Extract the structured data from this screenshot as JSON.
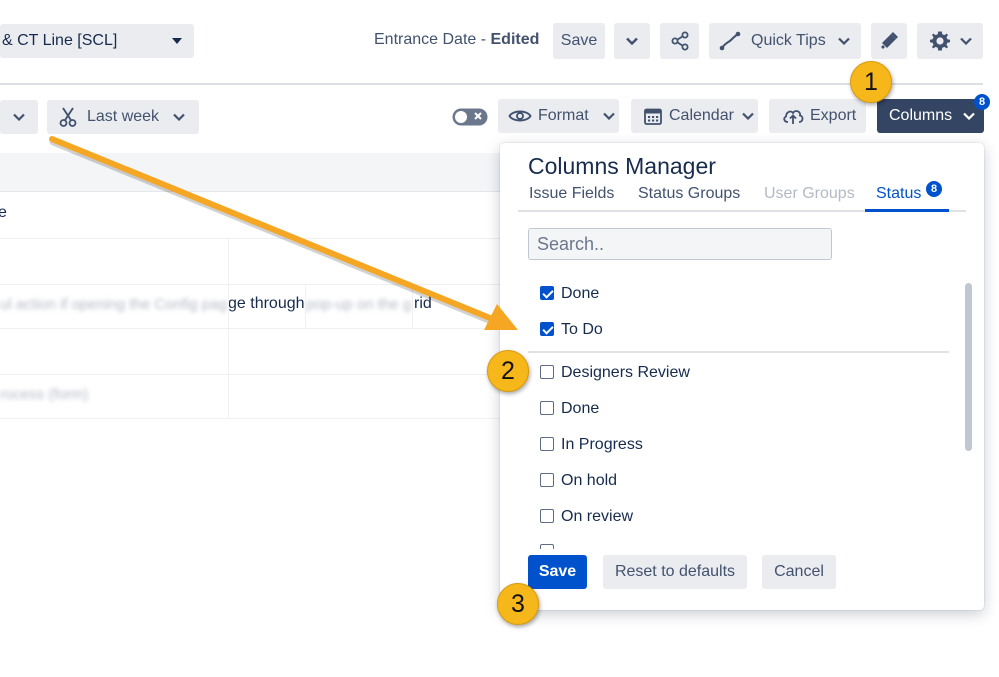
{
  "header": {
    "selector_label": "& CT Line [SCL]",
    "title_prefix": "Entrance Date - ",
    "title_status": "Edited",
    "save_label": "Save",
    "quick_tips_label": "Quick Tips"
  },
  "toolbar": {
    "date_filter_label": "Last week",
    "format_label": "Format",
    "calendar_label": "Calendar",
    "export_label": "Export",
    "columns_label": "Columns",
    "columns_badge": "8"
  },
  "grid": {
    "row1_text": "e",
    "row3_blur_left": "ul action if opening the Config page through",
    "row3_visible": "ge through",
    "row3_blur_right": "pop-up on the g",
    "row3_end": "rid",
    "row5_blur": "rocess (form)"
  },
  "columns_manager": {
    "title": "Columns Manager",
    "tabs": [
      {
        "label": "Issue Fields",
        "state": "normal"
      },
      {
        "label": "Status Groups",
        "state": "normal"
      },
      {
        "label": "User Groups",
        "state": "disabled"
      },
      {
        "label": "Status",
        "state": "active",
        "badge": "8"
      }
    ],
    "search_placeholder": "Search..",
    "selected": [
      {
        "label": "Done",
        "checked": true
      },
      {
        "label": "To Do",
        "checked": true
      }
    ],
    "available": [
      {
        "label": "Designers Review",
        "checked": false
      },
      {
        "label": "Done",
        "checked": false
      },
      {
        "label": "In Progress",
        "checked": false
      },
      {
        "label": "On hold",
        "checked": false
      },
      {
        "label": "On review",
        "checked": false
      }
    ],
    "save_label": "Save",
    "reset_label": "Reset to defaults",
    "cancel_label": "Cancel"
  },
  "callouts": [
    "1",
    "2",
    "3"
  ],
  "colors": {
    "primary": "#0052cc",
    "columns_button": "#344563",
    "callout": "#f6b71a",
    "arrow": "#f5a623"
  }
}
